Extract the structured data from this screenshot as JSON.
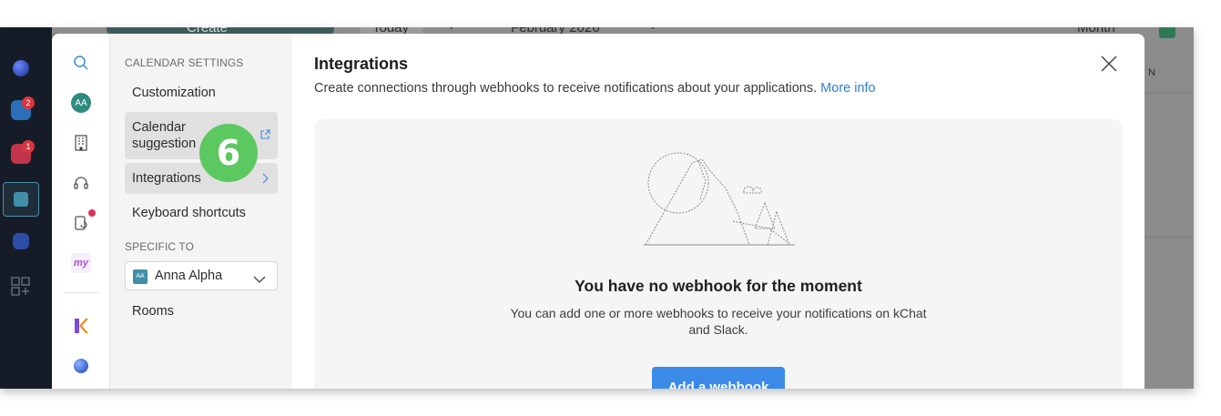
{
  "background_calendar": {
    "create_label": "Create",
    "today_label": "Today",
    "month_label": "February 2026",
    "view_label": "Month",
    "column_fragment": "N"
  },
  "app_rail": {
    "badges": [
      {
        "app": "mail-app",
        "count": "2"
      },
      {
        "app": "drive-app",
        "count": "1"
      }
    ]
  },
  "settings_modal": {
    "section_calendar_settings": "CALENDAR SETTINGS",
    "nav_items": [
      {
        "label": "Customization"
      },
      {
        "label": "Calendar suggestion"
      },
      {
        "label": "Integrations"
      },
      {
        "label": "Keyboard shortcuts"
      }
    ],
    "section_specific_to": "SPECIFIC TO",
    "calendar_select": {
      "avatar": "AA",
      "value": "Anna Alpha"
    },
    "rooms_label": "Rooms",
    "user_avatar": "AA",
    "page": {
      "title": "Integrations",
      "description": "Create connections through webhooks to receive notifications about your applications.",
      "more_info": "More info",
      "empty_title": "You have no webhook for the moment",
      "empty_description": "You can add one or more webhooks to receive your notifications on kChat and Slack.",
      "add_button": "Add a webhook"
    }
  },
  "step_marker": "6",
  "colors": {
    "accent_blue": "#3b8ae8",
    "link_blue": "#2d7fd8",
    "step_green": "#5cc860",
    "avatar_teal": "#2f8a80",
    "rail_dark": "#161c27"
  }
}
